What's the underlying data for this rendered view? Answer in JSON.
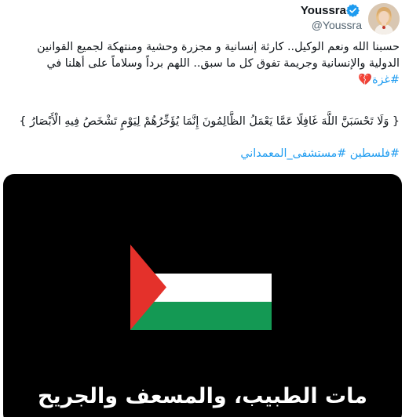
{
  "author": {
    "display_name": "Youssra",
    "handle": "@Youssra",
    "verified": true,
    "avatar_icon": "user-avatar-photo"
  },
  "tweet": {
    "lines": [
      "حسبنا الله ونعم الوكيل.. كارثة إنسانية و مجزرة وحشية ومنتهكة لجميع القوانين",
      "الدولية والإنسانية وجريمة تفوق كل ما سبق.. اللهم برداً وسلاماً على أهلنا في"
    ],
    "hashtag_gaza": "#غزة",
    "broken_heart": "💔",
    "quran_verse": "{ وَلَا تَحْسَبَنَّ اللَّهَ غَافِلًا عَمَّا يَعْمَلُ الظَّالِمُونَ إِنَّمَا يُؤَخِّرُهُمْ لِيَوْمٍ تَشْخَصُ فِيهِ الْأَبْصَارُ }",
    "hashtags": [
      "#فلسطين",
      "#مستشفى_المعمداني"
    ]
  },
  "media": {
    "background_color": "#000000",
    "flag_icon": "palestine-flag",
    "flag_colors": {
      "black": "#000000",
      "white": "#ffffff",
      "green": "#149954",
      "red": "#e4312b"
    },
    "caption": "مات الطبيب، والمسعف والجريح"
  },
  "colors": {
    "link": "#1d9bf0",
    "text": "#0f1419",
    "secondary": "#536471"
  }
}
